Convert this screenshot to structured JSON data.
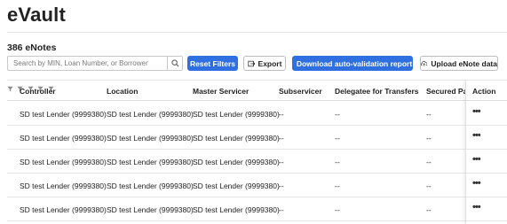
{
  "page": {
    "title": "eVault",
    "count_label": "386 eNotes"
  },
  "toolbar": {
    "search_placeholder": "Search by MIN, Loan Number, or Borrower",
    "reset_label": "Reset Filters",
    "export_label": "Export",
    "download_label": "Download auto-validation report",
    "upload_label": "Upload eNote data"
  },
  "colors": {
    "primary": "#2f6fe0",
    "border": "#c9c9c9"
  },
  "icons": {
    "search": "search-icon",
    "filter": "filter-icon",
    "export": "export-icon",
    "download": "cloud-download-icon",
    "upload": "cloud-upload-icon",
    "more": "more-horizontal-icon"
  },
  "table": {
    "columns": [
      {
        "label": "Controller",
        "filterable": true
      },
      {
        "label": "Location",
        "filterable": true
      },
      {
        "label": "Master Servicer",
        "filterable": true
      },
      {
        "label": "Subservicer",
        "filterable": true
      },
      {
        "label": "Delegatee for Transfers",
        "filterable": true
      },
      {
        "label": "Secured Party",
        "filterable": false
      },
      {
        "label": "Action",
        "filterable": false
      }
    ],
    "rows": [
      {
        "controller": "SD test Lender (9999380)",
        "location": "SD test Lender (9999380)",
        "master_servicer": "SD test Lender (9999380)",
        "subservicer": "--",
        "delegatee": "--",
        "secured_party": "--",
        "action": "•••"
      },
      {
        "controller": "SD test Lender (9999380)",
        "location": "SD test Lender (9999380)",
        "master_servicer": "SD test Lender (9999380)",
        "subservicer": "--",
        "delegatee": "--",
        "secured_party": "--",
        "action": "•••"
      },
      {
        "controller": "SD test Lender (9999380)",
        "location": "SD test Lender (9999380)",
        "master_servicer": "SD test Lender (9999380)",
        "subservicer": "--",
        "delegatee": "--",
        "secured_party": "--",
        "action": "•••"
      },
      {
        "controller": "SD test Lender (9999380)",
        "location": "SD test Lender (9999380)",
        "master_servicer": "SD test Lender (9999380)",
        "subservicer": "--",
        "delegatee": "--",
        "secured_party": "--",
        "action": "•••"
      },
      {
        "controller": "SD test Lender (9999380)",
        "location": "SD test Lender (9999380)",
        "master_servicer": "SD test Lender (9999380)",
        "subservicer": "--",
        "delegatee": "--",
        "secured_party": "--",
        "action": "•••"
      }
    ]
  }
}
